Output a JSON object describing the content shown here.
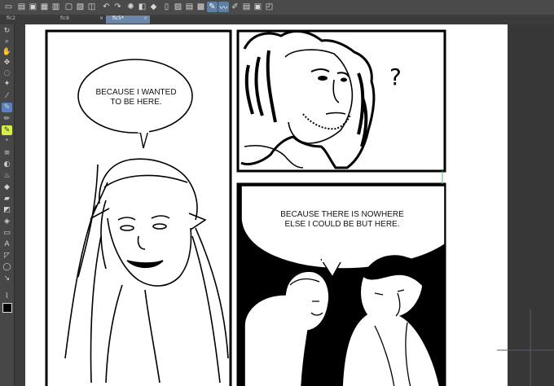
{
  "tabs": [
    {
      "label": "fic2"
    },
    {
      "label": "fic8"
    },
    {
      "label": "fic5*"
    }
  ],
  "toolbar_icons": [
    "new-icon",
    "open-icon",
    "save-icon",
    "export-icon",
    "print-icon",
    "undo-icon",
    "redo-icon",
    "loading-icon",
    "transform-icon",
    "fill-icon",
    "ruler-icon",
    "grid-icon",
    "snap-icon",
    "select-icon",
    "pen-icon",
    "brush-icon",
    "layer-icon",
    "zoom-icon"
  ],
  "tool_icons": [
    "rotate-icon",
    "zoom-icon",
    "hand-icon",
    "move-icon",
    "lasso-icon",
    "magic-wand-icon",
    "eyedropper-icon",
    "pen-tool-icon",
    "pencil-icon",
    "brush-tool-icon",
    "airbrush-icon",
    "blend-icon",
    "eraser-icon",
    "fill-tool-icon",
    "gradient-icon",
    "figure-icon",
    "frame-icon",
    "text-icon",
    "balloon-icon",
    "line-icon",
    "correction-icon"
  ],
  "comic": {
    "bubble1": "BECAUSE I WANTED TO BE HERE.",
    "bubble2": "BECAUSE THERE IS NOWHERE ELSE I COULD BE BUT HERE.",
    "question_mark": "?"
  },
  "colors": {
    "ui_dark": "#3a3a3a",
    "tab_active": "#6d87a8",
    "tool_selected": "#5a82c0",
    "tool_highlight": "#d8f046"
  }
}
